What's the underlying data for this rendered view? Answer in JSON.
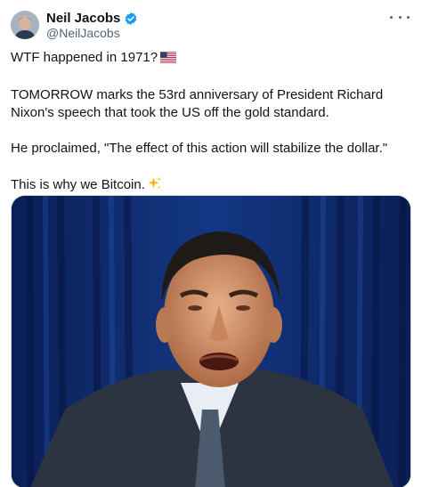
{
  "author": {
    "display_name": "Neil Jacobs",
    "handle": "@NeilJacobs"
  },
  "tweet": {
    "paragraphs": [
      "WTF happened in 1971?",
      "TOMORROW marks the 53rd anniversary of President Richard Nixon's speech that took the US off the gold standard.",
      "He proclaimed, \"The effect of this action will stabilize the dollar.\"",
      "This is why we Bitcoin."
    ]
  },
  "icons": {
    "verified": "verified-badge-icon",
    "more": "more-options-icon",
    "flag": "us-flag-emoji",
    "sparkles": "sparkles-emoji"
  },
  "colors": {
    "verified_blue": "#1d9bf0",
    "secondary_text": "#536471",
    "curtain_blue": "#0d2a6a"
  }
}
